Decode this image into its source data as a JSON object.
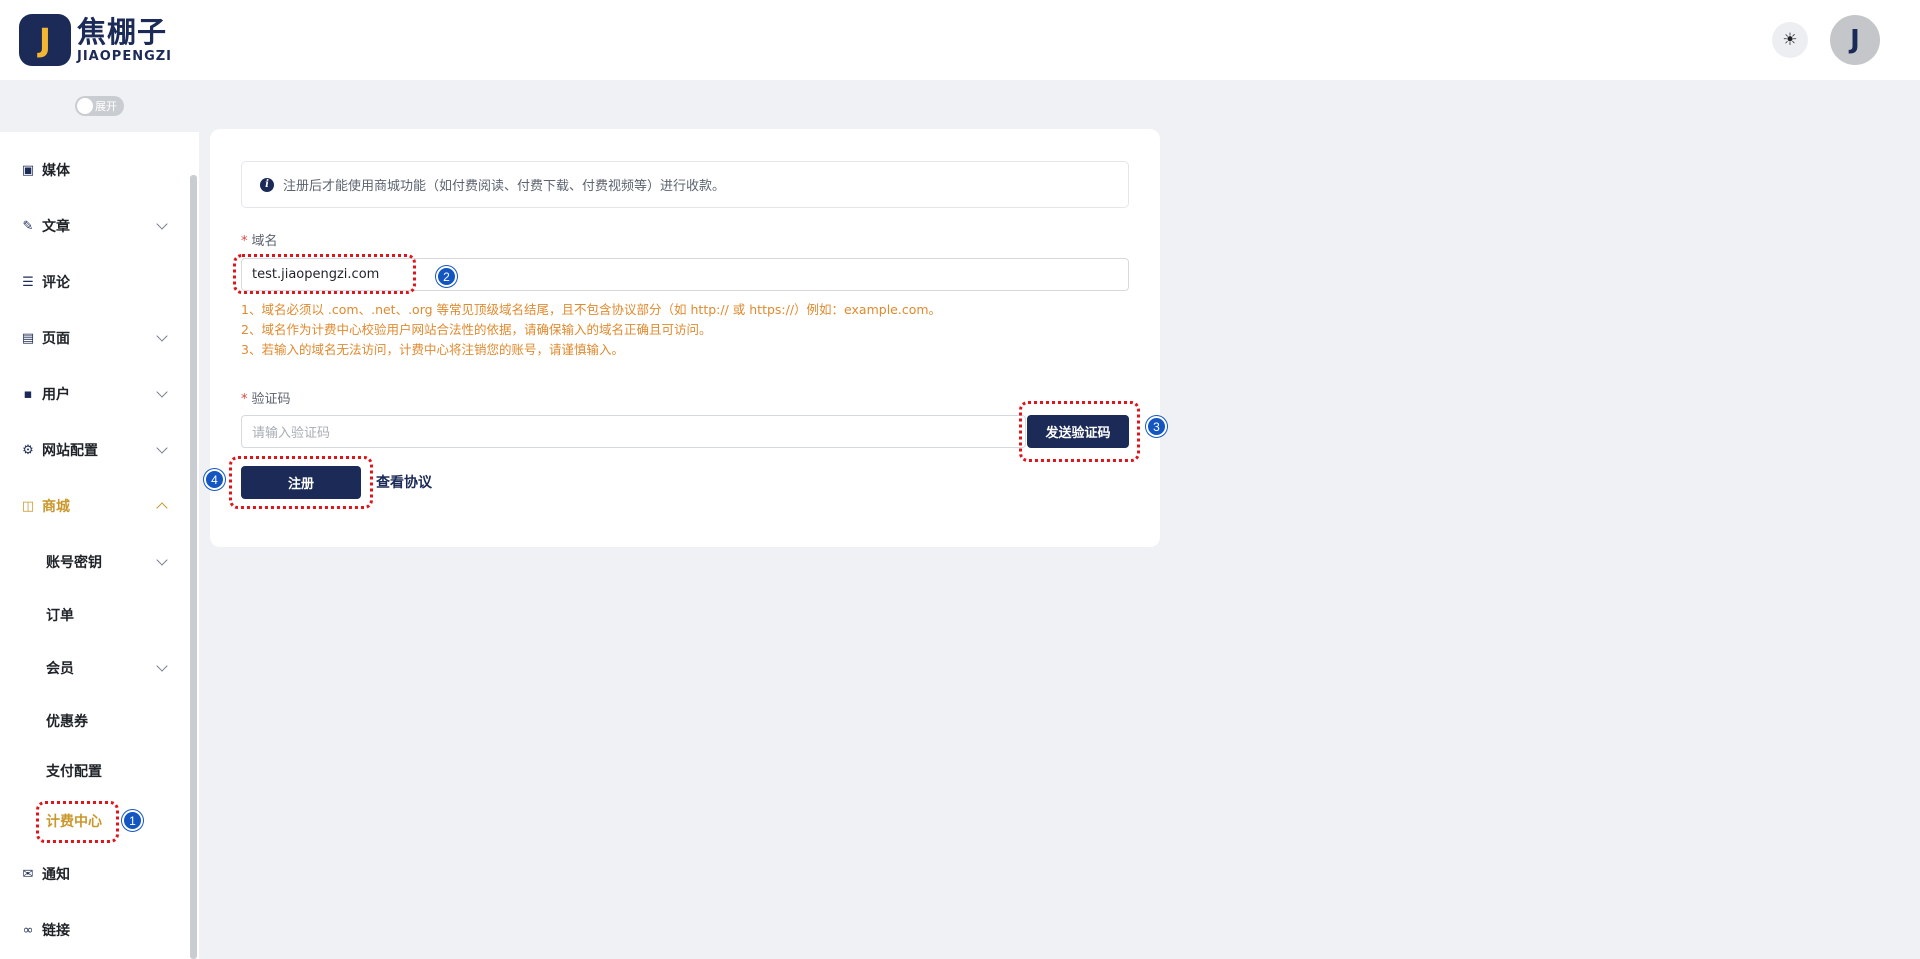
{
  "header": {
    "logo_mark": "J",
    "logo_cn": "焦棚子",
    "logo_en": "JIAOPENGZI",
    "theme_icon": "sun-icon",
    "theme_glyph": "☀",
    "avatar_letter": "J"
  },
  "toggle": {
    "label": "展开"
  },
  "sidebar": {
    "items": [
      {
        "label": "媒体",
        "icon": "media-icon",
        "glyph": "▣"
      },
      {
        "label": "文章",
        "icon": "article-edit-icon",
        "glyph": "✎"
      },
      {
        "label": "评论",
        "icon": "comment-icon",
        "glyph": "☰"
      },
      {
        "label": "页面",
        "icon": "page-icon",
        "glyph": "▤"
      },
      {
        "label": "用户",
        "icon": "user-icon",
        "glyph": "▪"
      },
      {
        "label": "网站配置",
        "icon": "gear-icon",
        "glyph": "⚙"
      },
      {
        "label": "商城",
        "icon": "shop-icon",
        "glyph": "◫"
      },
      {
        "label": "通知",
        "icon": "mail-icon",
        "glyph": "✉"
      },
      {
        "label": "链接",
        "icon": "link-icon",
        "glyph": "∞"
      }
    ],
    "shop_sub": [
      {
        "label": "账号密钥"
      },
      {
        "label": "订单"
      },
      {
        "label": "会员"
      },
      {
        "label": "优惠券"
      },
      {
        "label": "支付配置"
      },
      {
        "label": "计费中心"
      }
    ]
  },
  "main": {
    "alert_text": "注册后才能使用商城功能（如付费阅读、付费下载、付费视频等）进行收款。",
    "domain": {
      "label": "域名",
      "value": "test.jiaopengzi.com",
      "hints": [
        "1、域名必须以 .com、.net、.org 等常见顶级域名结尾，且不包含协议部分（如 http:// 或 https://）例如：example.com。",
        "2、域名作为计费中心校验用户网站合法性的依据，请确保输入的域名正确且可访问。",
        "3、若输入的域名无法访问，计费中心将注销您的账号，请谨慎输入。"
      ]
    },
    "code": {
      "label": "验证码",
      "placeholder": "请输入验证码",
      "send_button": "发送验证码"
    },
    "register_button": "注册",
    "view_agreement": "查看协议"
  },
  "annotations": [
    "1",
    "2",
    "3",
    "4"
  ],
  "colors": {
    "brand_navy": "#1b2a56",
    "accent_gold": "#c9972b",
    "hint_orange": "#e08a2e",
    "annotation_red": "#e0151b",
    "annotation_blue": "#1356c2"
  }
}
